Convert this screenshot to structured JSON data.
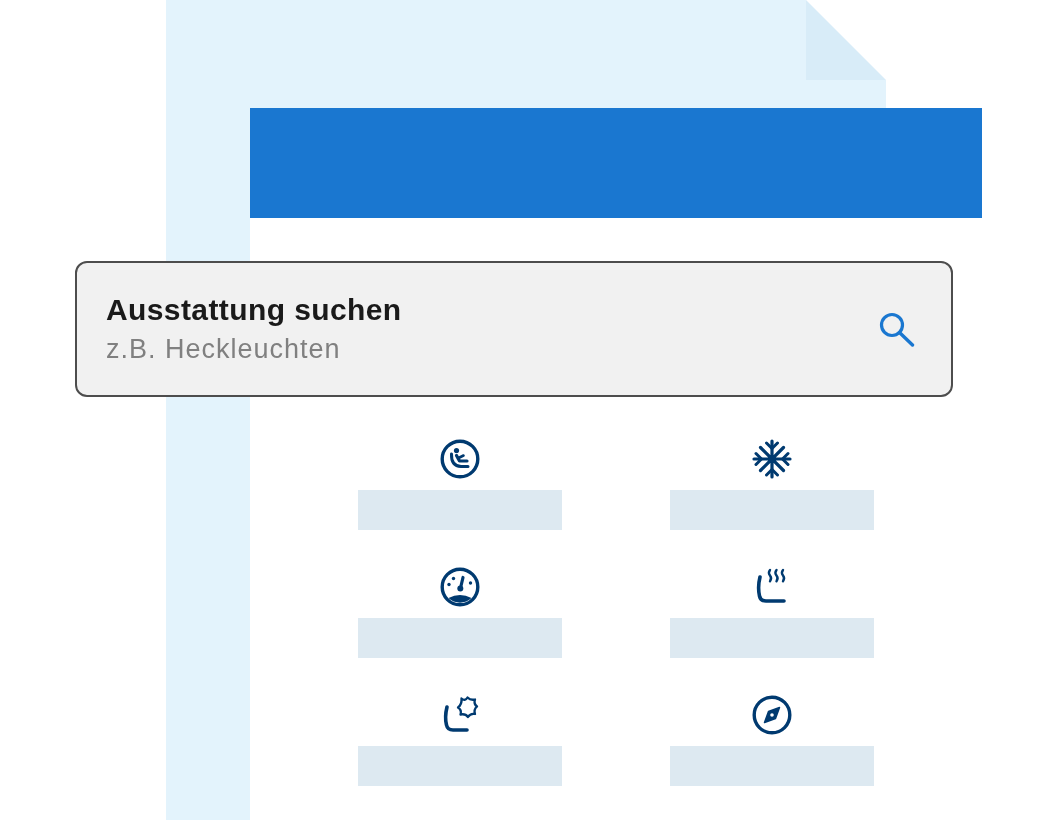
{
  "search": {
    "label": "Ausstattung suchen",
    "placeholder": "z.B. Heckleuchten"
  },
  "features": [
    {
      "kind": "child_seat"
    },
    {
      "kind": "snowflake"
    },
    {
      "kind": "gauge"
    },
    {
      "kind": "heated_seat"
    },
    {
      "kind": "leather_seat"
    },
    {
      "kind": "compass"
    }
  ]
}
